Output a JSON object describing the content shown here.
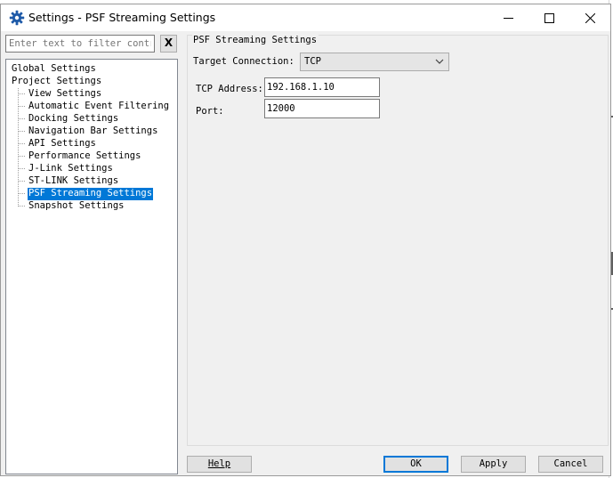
{
  "window": {
    "title": "Settings - PSF Streaming Settings",
    "icon": "gear-icon",
    "accent": "#0078d7",
    "background_app_top_text": "80"
  },
  "filter": {
    "placeholder": "Enter text to filter contro",
    "clear_label": "X"
  },
  "tree": {
    "items": [
      {
        "label": "Global Settings",
        "level": 0
      },
      {
        "label": "Project Settings",
        "level": 0
      },
      {
        "label": "View Settings",
        "level": 1
      },
      {
        "label": "Automatic Event Filtering",
        "level": 1
      },
      {
        "label": "Docking Settings",
        "level": 1
      },
      {
        "label": "Navigation Bar Settings",
        "level": 1
      },
      {
        "label": "API Settings",
        "level": 1
      },
      {
        "label": "Performance Settings",
        "level": 1
      },
      {
        "label": "J-Link Settings",
        "level": 1
      },
      {
        "label": "ST-LINK Settings",
        "level": 1
      },
      {
        "label": "PSF Streaming Settings",
        "level": 1,
        "selected": true
      },
      {
        "label": "Snapshot Settings",
        "level": 1
      }
    ]
  },
  "panel": {
    "group_title": "PSF Streaming Settings",
    "target_connection_label": "Target Connection:",
    "target_connection_value": "TCP",
    "tcp_address_label": "TCP Address:",
    "tcp_address_value": "192.168.1.10",
    "port_label": "Port:",
    "port_value": "12000"
  },
  "buttons": {
    "help": "Help",
    "ok": "OK",
    "apply": "Apply",
    "cancel": "Cancel"
  }
}
